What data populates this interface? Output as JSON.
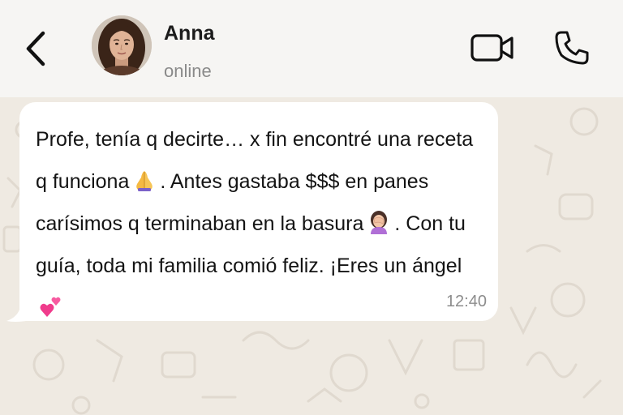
{
  "header": {
    "contact_name": "Anna",
    "status": "online"
  },
  "message": {
    "part1": "Profe, tenía q decirte… x fin encontré una receta q funciona",
    "part2": ". Antes gastaba $$$ en panes carísimos q terminaban en la basura",
    "part3": ". Con tu guía, toda mi familia comió feliz. ¡Eres un ángel",
    "emoji1": "folded-hands-emoji",
    "emoji2": "facepalm-emoji",
    "emoji3": "two-hearts-emoji",
    "time": "12:40"
  },
  "colors": {
    "header_bg": "#f6f5f3",
    "chat_bg": "#efeae2",
    "bubble_bg": "#ffffff",
    "muted_text": "#8a8a8a"
  }
}
